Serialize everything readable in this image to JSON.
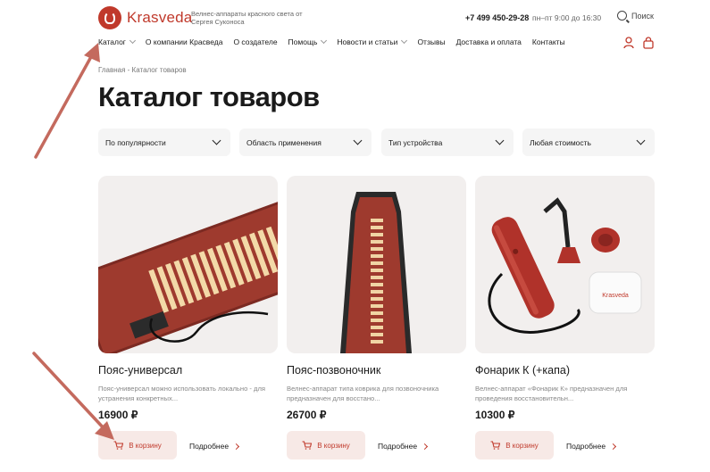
{
  "header": {
    "brand": "Krasveda",
    "tagline": "Велнес-аппараты красного света от Сергея Суконоса",
    "phone": "+7 499 450-29-28",
    "hours": "пн–пт 9:00 до 16:30",
    "search_label": "Поиск"
  },
  "nav": [
    {
      "label": "Каталог",
      "has_dropdown": true
    },
    {
      "label": "О компании Красведа",
      "has_dropdown": false
    },
    {
      "label": "О создателе",
      "has_dropdown": false
    },
    {
      "label": "Помощь",
      "has_dropdown": true
    },
    {
      "label": "Новости и статьи",
      "has_dropdown": true
    },
    {
      "label": "Отзывы",
      "has_dropdown": false
    },
    {
      "label": "Доставка и оплата",
      "has_dropdown": false
    },
    {
      "label": "Контакты",
      "has_dropdown": false
    }
  ],
  "breadcrumb": "Главная - Каталог товаров",
  "page_title": "Каталог товаров",
  "filters": [
    {
      "label": "По популярности"
    },
    {
      "label": "Область применения"
    },
    {
      "label": "Тип устройства"
    },
    {
      "label": "Любая стоимость"
    }
  ],
  "products": [
    {
      "name": "Пояс-универсал",
      "description": "Пояс-универсал можно использовать локально - для устранения конкретных...",
      "price": "16900 ₽",
      "cart_label": "В корзину",
      "more_label": "Подробнее"
    },
    {
      "name": "Пояс-позвоночник",
      "description": "Велнес-аппарат типа коврика для позвоночника предназначен для восстано...",
      "price": "26700 ₽",
      "cart_label": "В корзину",
      "more_label": "Подробнее"
    },
    {
      "name": "Фонарик К (+капа)",
      "description": "Велнес-аппарат «Фонарик К» предназначен для проведения восстановительн...",
      "price": "10300 ₽",
      "cart_label": "В корзину",
      "more_label": "Подробнее"
    }
  ],
  "colors": {
    "accent": "#c0392b",
    "button_bg": "#f7e9e6",
    "filter_bg": "#f5f5f5",
    "annotation_arrow": "#c46a5e"
  },
  "icons": [
    "logo-icon",
    "search-icon",
    "user-icon",
    "cart-icon",
    "chevron-down-icon",
    "chevron-right-icon"
  ]
}
